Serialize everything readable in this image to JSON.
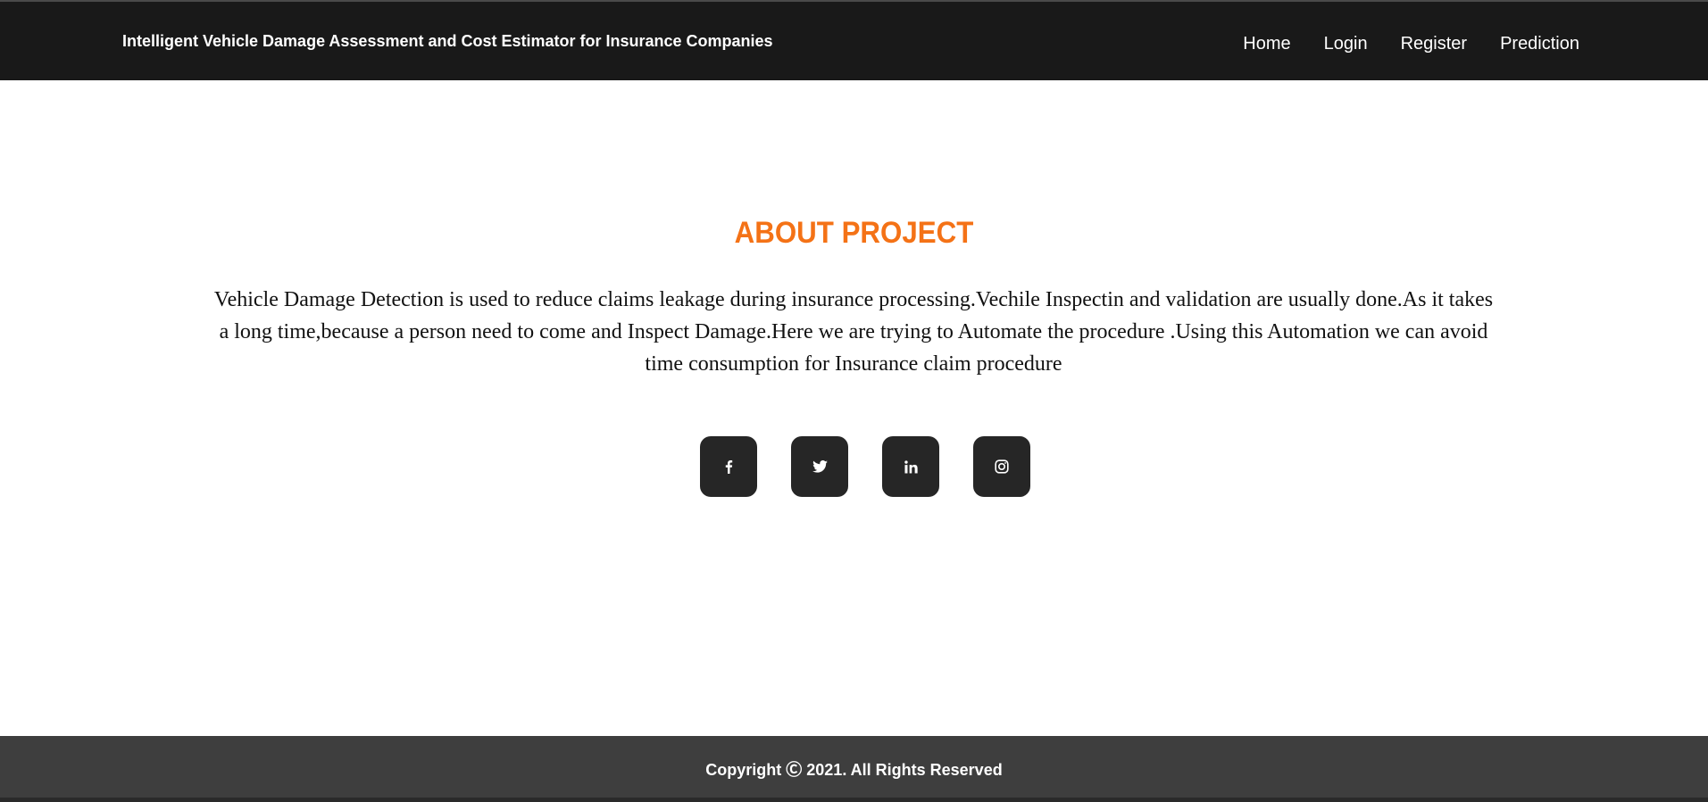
{
  "header": {
    "brand": "Intelligent Vehicle Damage Assessment and Cost Estimator for Insurance Companies",
    "nav": [
      "Home",
      "Login",
      "Register",
      "Prediction"
    ]
  },
  "about": {
    "title": "ABOUT PROJECT",
    "text": "Vehicle Damage Detection is used to reduce claims leakage during insurance processing.Vechile Inspectin and validation are usually done.As it takes a long time,because a person need to come and Inspect Damage.Here we are trying to Automate the procedure .Using this Automation we can avoid time consumption for Insurance claim procedure"
  },
  "social": [
    {
      "icon": "facebook-icon"
    },
    {
      "icon": "twitter-icon"
    },
    {
      "icon": "linkedin-icon"
    },
    {
      "icon": "instagram-icon"
    }
  ],
  "footer": {
    "copyright": "Copyright Ⓒ 2021. All Rights Reserved"
  },
  "colors": {
    "header_bg": "#191919",
    "accent": "#f47216",
    "social_bg": "#262626",
    "footer_bg": "#3e3e3e"
  }
}
